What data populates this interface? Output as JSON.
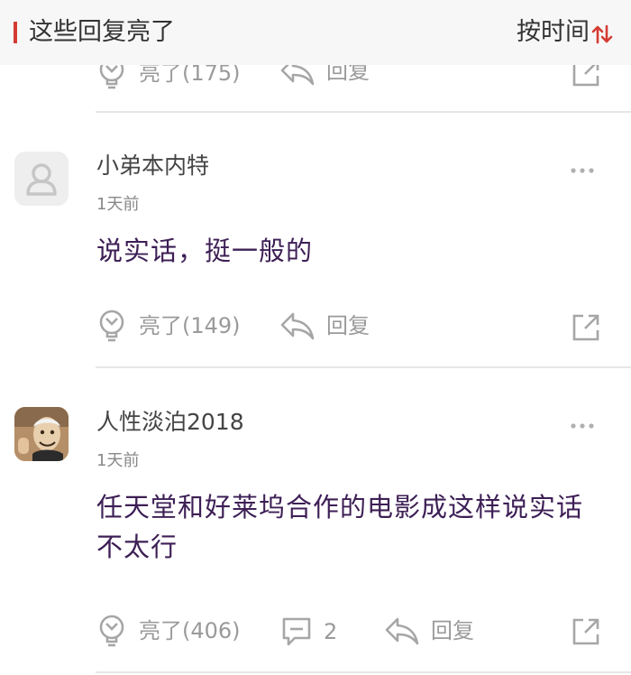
{
  "header": {
    "title": "这些回复亮了",
    "sort_label": "按时间"
  },
  "colors": {
    "accent": "#d43c33",
    "comment_text": "#3d1f55",
    "meta": "#888888",
    "action": "#9a9a9a"
  },
  "top_actions": {
    "like_label": "亮了(175)",
    "reply_label": "回复"
  },
  "comments": [
    {
      "username": "小弟本内特",
      "time": "1天前",
      "content": "说实话，挺一般的",
      "like_label": "亮了(149)",
      "reply_label": "回复",
      "avatar": "default-avatar"
    },
    {
      "username": "人性淡泊2018",
      "time": "1天前",
      "content": "任天堂和好莱坞合作的电影成这样说实话不太行",
      "like_label": "亮了(406)",
      "comment_count": "2",
      "reply_label": "回复",
      "avatar": "photo-avatar"
    }
  ],
  "icons": {
    "like": "lightbulb-icon",
    "reply": "reply-arrow-icon",
    "share": "share-icon",
    "comment": "comment-bubble-icon",
    "more": "more-dots-icon",
    "sort": "sort-arrows-icon"
  }
}
